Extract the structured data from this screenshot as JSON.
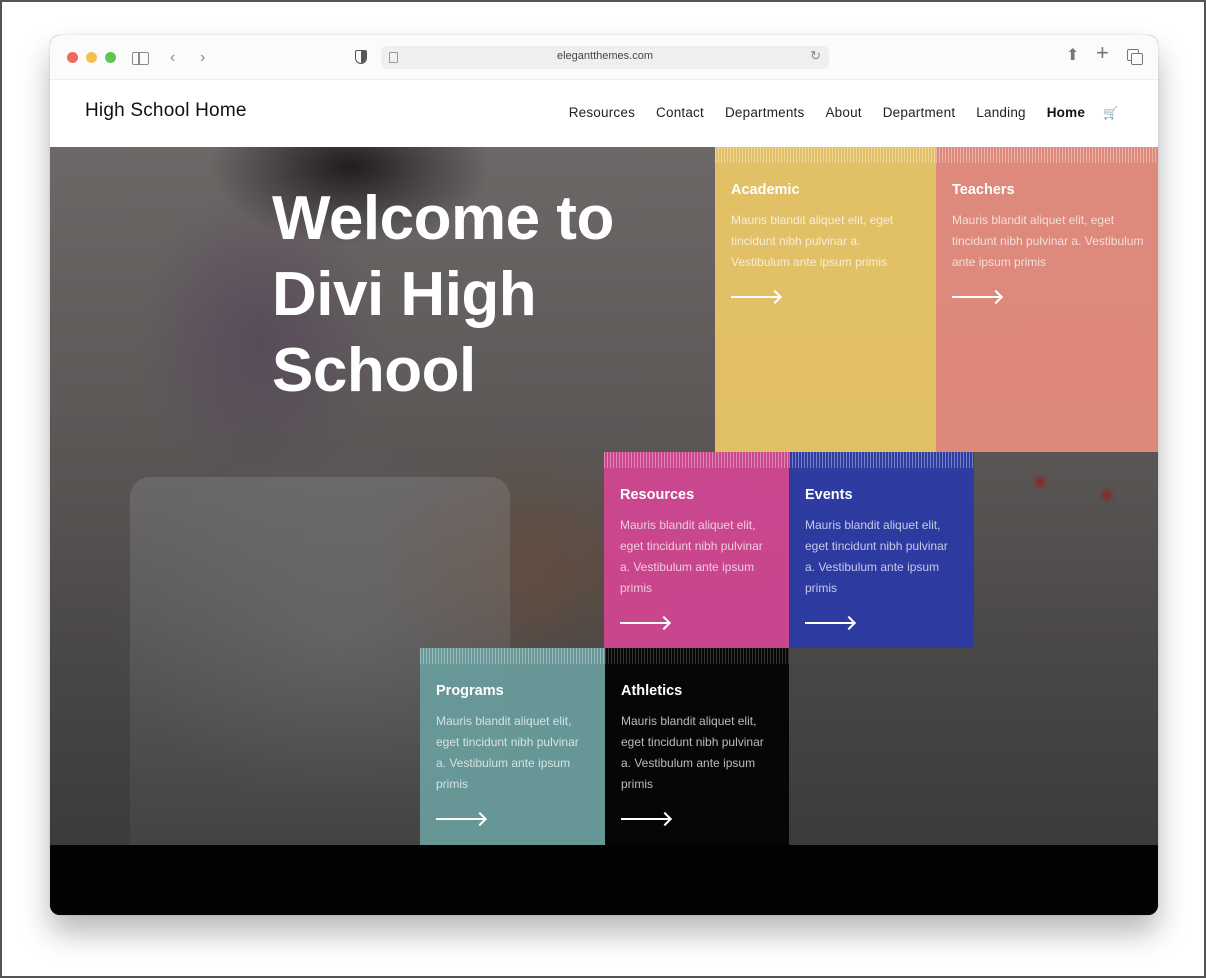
{
  "browser": {
    "url": "elegantthemes.com",
    "icons": [
      "sidebar-icon",
      "back-icon",
      "forward-icon",
      "privacy-shield-icon",
      "page-icon",
      "reload-icon",
      "share-icon",
      "new-tab-icon",
      "tabs-overview-icon"
    ]
  },
  "site": {
    "title": "High School Home",
    "nav": [
      {
        "label": "Resources"
      },
      {
        "label": "Contact"
      },
      {
        "label": "Departments"
      },
      {
        "label": "About"
      },
      {
        "label": "Department"
      },
      {
        "label": "Landing"
      },
      {
        "label": "Home",
        "active": true
      }
    ],
    "cart_icon": "cart-icon"
  },
  "hero": {
    "title": "Welcome to Divi High School"
  },
  "tiles": [
    {
      "title": "Academic",
      "body": "Mauris blandit aliquet elit, eget tincidunt nibh pulvinar a. Vestibulum ante ipsum primis",
      "color": "#e7c465"
    },
    {
      "title": "Teachers",
      "body": "Mauris blandit aliquet elit, eget tincidunt nibh pulvinar a. Vestibulum ante ipsum primis",
      "color": "#e28a7c"
    },
    {
      "title": "Resources",
      "body": "Mauris blandit aliquet elit, eget tincidunt nibh pulvinar a. Vestibulum ante ipsum primis",
      "color": "#da4696"
    },
    {
      "title": "Events",
      "body": "Mauris blandit aliquet elit, eget tincidunt nibh pulvinar a. Vestibulum ante ipsum primis",
      "color": "#2a3aa8"
    },
    {
      "title": "Programs",
      "body": "Mauris blandit aliquet elit, eget tincidunt nibh pulvinar a. Vestibulum ante ipsum primis",
      "color": "#699b9b"
    },
    {
      "title": "Athletics",
      "body": "Mauris blandit aliquet elit, eget tincidunt nibh pulvinar a. Vestibulum ante ipsum primis",
      "color": "#050303"
    }
  ]
}
